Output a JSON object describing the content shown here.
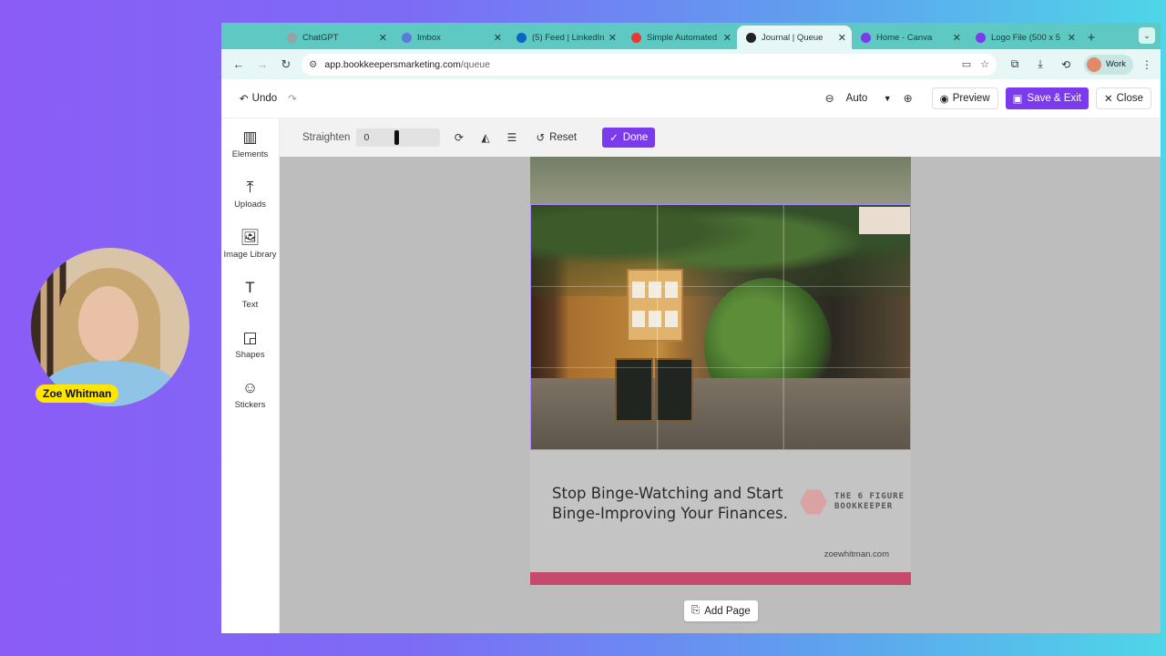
{
  "presenter": {
    "name": "Zoe Whitman"
  },
  "browser": {
    "tabs": [
      {
        "label": "ChatGPT",
        "color": "#9aa0a6",
        "active": false
      },
      {
        "label": "Imbox",
        "color": "#5b7bd6",
        "active": false
      },
      {
        "label": "(5) Feed | LinkedIn",
        "color": "#0a66c2",
        "active": false
      },
      {
        "label": "Simple Automated",
        "color": "#e53935",
        "active": false
      },
      {
        "label": "Journal | Queue",
        "color": "#222222",
        "active": true
      },
      {
        "label": "Home - Canva",
        "color": "#7c3aed",
        "active": false
      },
      {
        "label": "Logo File (500 x 5",
        "color": "#7c3aed",
        "active": false
      }
    ],
    "url_host": "app.bookkeepersmarketing.com",
    "url_path": "/queue",
    "profile_label": "Work"
  },
  "header": {
    "undo_label": "Undo",
    "zoom_value": "Auto",
    "preview_label": "Preview",
    "save_label": "Save & Exit",
    "close_label": "Close"
  },
  "sidebar": {
    "items": [
      {
        "label": "Elements",
        "icon": "elements-icon",
        "glyph": "▥"
      },
      {
        "label": "Uploads",
        "icon": "upload-icon",
        "glyph": "⤒"
      },
      {
        "label": "Image Library",
        "icon": "image-icon",
        "glyph": "🖼"
      },
      {
        "label": "Text",
        "icon": "text-icon",
        "glyph": "T"
      },
      {
        "label": "Shapes",
        "icon": "shapes-icon",
        "glyph": "◲"
      },
      {
        "label": "Stickers",
        "icon": "sticker-icon",
        "glyph": "☺"
      }
    ]
  },
  "cropbar": {
    "straighten_label": "Straighten",
    "straighten_value": "0",
    "reset_label": "Reset",
    "done_label": "Done"
  },
  "design": {
    "headline": "Stop Binge-Watching and Start Binge-Improving Your Finances.",
    "logo_line1": "THE 6 FIGURE",
    "logo_line2": "BOOKKEEPER",
    "website": "zoewhitman.com"
  },
  "add_page_label": "Add Page",
  "colors": {
    "accent": "#7c3aed",
    "brand_bar": "#c6486b"
  }
}
